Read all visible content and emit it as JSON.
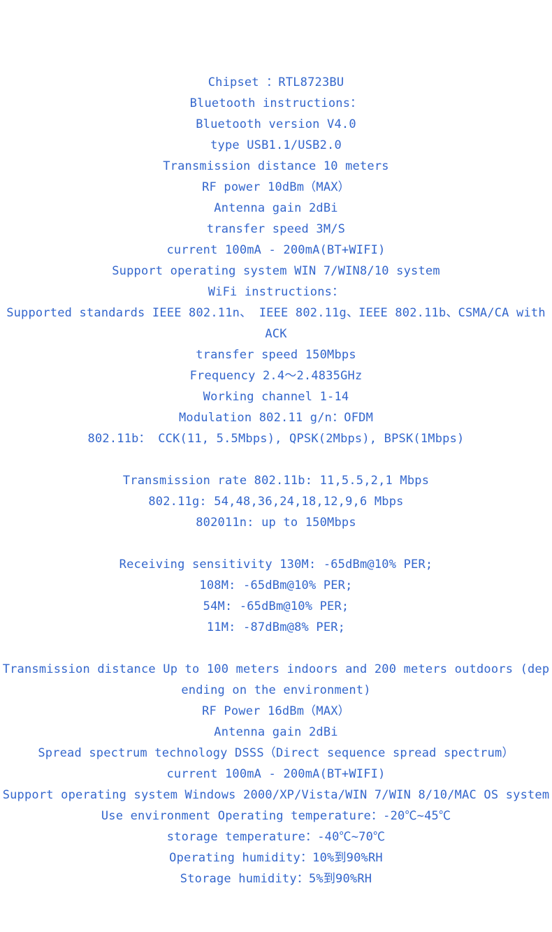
{
  "document": {
    "text_color": "#3366cc",
    "background_color": "#ffffff",
    "lines": [
      {
        "id": "chipset",
        "text": "Chipset  ：RTL8723BU"
      },
      {
        "id": "bluetooth-heading",
        "text": "Bluetooth  instructions："
      },
      {
        "id": "bluetooth-version",
        "text": "Bluetooth  version  V4.0"
      },
      {
        "id": "bluetooth-type",
        "text": "type  USB1.1/USB2.0"
      },
      {
        "id": "bluetooth-distance",
        "text": "Transmission  distance  10  meters"
      },
      {
        "id": "bluetooth-rf-power",
        "text": "RF  power  10dBm（MAX）"
      },
      {
        "id": "bluetooth-antenna-gain",
        "text": "Antenna  gain  2dBi"
      },
      {
        "id": "bluetooth-transfer-speed",
        "text": "transfer  speed  3M/S"
      },
      {
        "id": "bluetooth-current",
        "text": "current  100mA  -  200mA(BT+WIFI)"
      },
      {
        "id": "bluetooth-os-support",
        "text": "Support  operating  system   WIN 7/WIN8/10  system"
      },
      {
        "id": "wifi-heading",
        "text": "WiFi  instructions："
      },
      {
        "id": "wifi-standards",
        "text": "Supported  standards  IEEE  802.11n、  IEEE  802.11g、IEEE  802.11b、CSMA/CA with  ACK"
      },
      {
        "id": "wifi-transfer-speed",
        "text": "transfer  speed  150Mbps"
      },
      {
        "id": "wifi-frequency",
        "text": "Frequency  2.4～2.4835GHz"
      },
      {
        "id": "wifi-working-channel",
        "text": "Working  channel  1-14"
      },
      {
        "id": "wifi-modulation",
        "text": "Modulation  802.11  g/n：OFDM"
      },
      {
        "id": "wifi-modulation-11b",
        "text": "802.11b： CCK(11,  5.5Mbps),  QPSK(2Mbps),  BPSK(1Mbps)"
      },
      {
        "id": "spacer-1",
        "text": ""
      },
      {
        "id": "wifi-rate-11b",
        "text": "Transmission  rate  802.11b:  11,5.5,2,1  Mbps"
      },
      {
        "id": "wifi-rate-11g",
        "text": "802.11g:  54,48,36,24,18,12,9,6  Mbps"
      },
      {
        "id": "wifi-rate-11n",
        "text": "802011n:  up  to  150Mbps"
      },
      {
        "id": "spacer-2",
        "text": ""
      },
      {
        "id": "sensitivity-130m",
        "text": "Receiving  sensitivity 130M:   -65dBm@10%  PER;"
      },
      {
        "id": "sensitivity-108m",
        "text": "108M: -65dBm@10%  PER;"
      },
      {
        "id": "sensitivity-54m",
        "text": "54M: -65dBm@10%  PER;"
      },
      {
        "id": "sensitivity-11m",
        "text": "11M: -87dBm@8%  PER;"
      },
      {
        "id": "spacer-3",
        "text": ""
      },
      {
        "id": "wifi-distance",
        "text": "Transmission  distance  Up  to  100  meters  indoors  and  200  meters  outdoors  (depending  on  the  environment)"
      },
      {
        "id": "wifi-rf-power",
        "text": "RF  Power  16dBm（MAX）"
      },
      {
        "id": "wifi-antenna-gain",
        "text": "Antenna  gain  2dBi"
      },
      {
        "id": "wifi-spread-spectrum",
        "text": "Spread  spectrum  technology  DSSS（Direct  sequence  spread  spectrum）"
      },
      {
        "id": "wifi-current",
        "text": "current  100mA  -  200mA(BT+WIFI)"
      },
      {
        "id": "wifi-os-support",
        "text": "Support  operating  system Windows  2000/XP/Vista/WIN  7/WIN  8/10/MAC  OS  system"
      },
      {
        "id": "env-operating-temp",
        "text": "Use  environment  Operating  temperature：-20℃~45℃"
      },
      {
        "id": "env-storage-temp",
        "text": "storage  temperature：-40℃~70℃"
      },
      {
        "id": "env-operating-humidity",
        "text": "Operating  humidity：10%到90%RH"
      },
      {
        "id": "env-storage-humidity",
        "text": "Storage  humidity：5%到90%RH"
      }
    ]
  }
}
